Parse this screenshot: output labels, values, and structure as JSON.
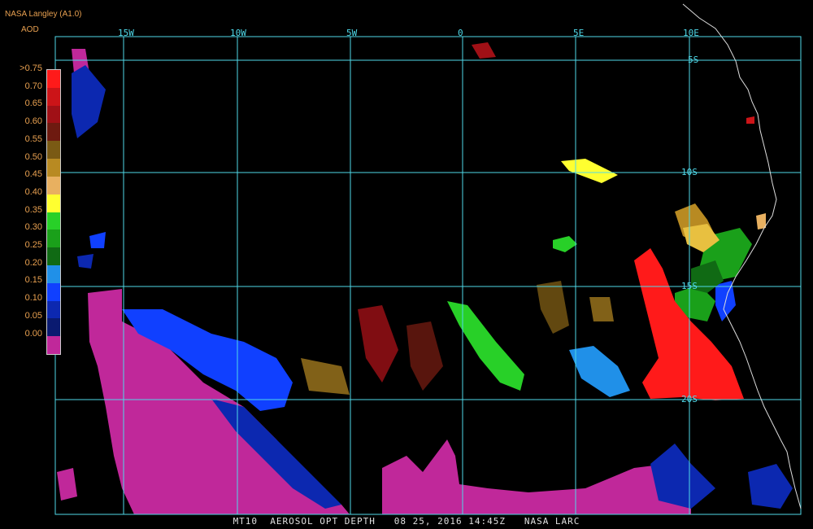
{
  "header": {
    "source": "NASA Langley (A1.0)",
    "product": "AOD"
  },
  "longitude_labels": [
    "15W",
    "10W",
    "5W",
    "0",
    "5E",
    "10E"
  ],
  "latitude_labels": [
    "5S",
    "10S",
    "15S",
    "20S"
  ],
  "legend": {
    "labels": [
      ">0.75",
      "0.70",
      "0.65",
      "0.60",
      "0.55",
      "0.50",
      "0.45",
      "0.40",
      "0.35",
      "0.30",
      "0.25",
      "0.20",
      "0.15",
      "0.10",
      "0.05",
      "0.00"
    ],
    "colors": [
      "#ff1a1a",
      "#cc1418",
      "#a01016",
      "#6e1a10",
      "#7a5a14",
      "#b88a22",
      "#e8b060",
      "#ffff30",
      "#28d028",
      "#1aa01a",
      "#106a14",
      "#2090e8",
      "#1040ff",
      "#0c28b0",
      "#0a1a70",
      "#c0289a"
    ]
  },
  "footer": "MT10  AEROSOL OPT DEPTH   08 25, 2016 14:45Z   NASA LARC",
  "colors": {
    "grid": "#4fd8e8",
    "coast": "#dddddd",
    "background": "#000000"
  }
}
